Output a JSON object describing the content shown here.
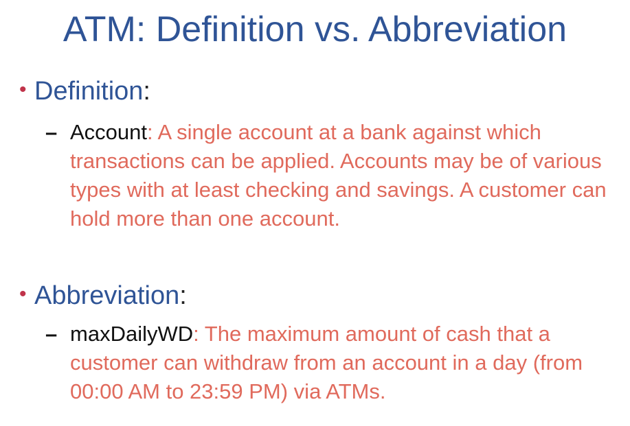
{
  "title": "ATM: Definition vs. Abbreviation",
  "sections": [
    {
      "heading": "Definition",
      "colon": ":",
      "dash": "–",
      "term": "Account",
      "body": ": A single account at a bank against which transactions can be applied. Accounts may be of various types with at least checking and savings. A customer can hold more than one account."
    },
    {
      "heading": "Abbreviation",
      "colon": ":",
      "dash": "–",
      "term": "maxDailyWD",
      "body": ": The maximum amount of cash that a customer can withdraw from an account in a day (from 00:00 AM to 23:59 PM) via ATMs."
    }
  ],
  "colors": {
    "title": "#2f5496",
    "bullet": "#c0334a",
    "body": "#e06a5c",
    "term": "#111111"
  }
}
